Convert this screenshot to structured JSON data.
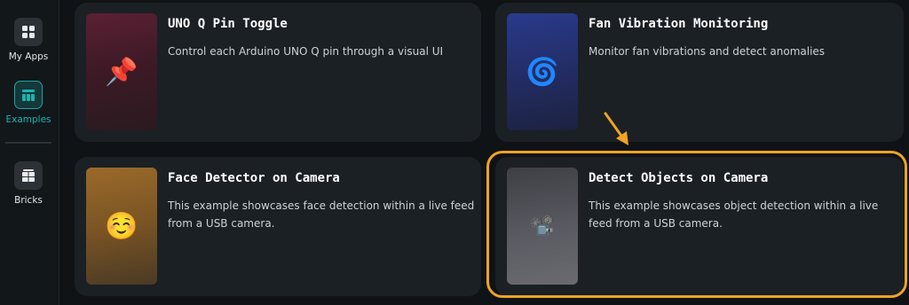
{
  "sidebar": {
    "items": [
      {
        "label": "My Apps",
        "icon": "grid-icon",
        "active": false
      },
      {
        "label": "Examples",
        "icon": "table-icon",
        "active": true
      },
      {
        "label": "Bricks",
        "icon": "bricks-icon",
        "active": false
      }
    ]
  },
  "examples": [
    {
      "title": "UNO Q Pin Toggle",
      "description": "Control each Arduino UNO Q pin through a visual UI",
      "icon": "pushpin-icon",
      "glyph": "📌"
    },
    {
      "title": "Fan Vibration Monitoring",
      "description": "Monitor fan vibrations and detect anomalies",
      "icon": "spiral-icon",
      "glyph": "🌀"
    },
    {
      "title": "Face Detector on Camera",
      "description": "This example showcases face detection within a live feed from a USB camera.",
      "icon": "smiling-face-icon",
      "glyph": "☺️"
    },
    {
      "title": "Detect Objects on Camera",
      "description": "This example showcases object detection within a live feed from a USB camera.",
      "icon": "movie-camera-icon",
      "glyph": "📽️"
    }
  ],
  "colors": {
    "accent": "#19a6a3",
    "highlight": "#f0a323",
    "card_bg": "#1b2024",
    "page_bg": "#0f1316"
  }
}
